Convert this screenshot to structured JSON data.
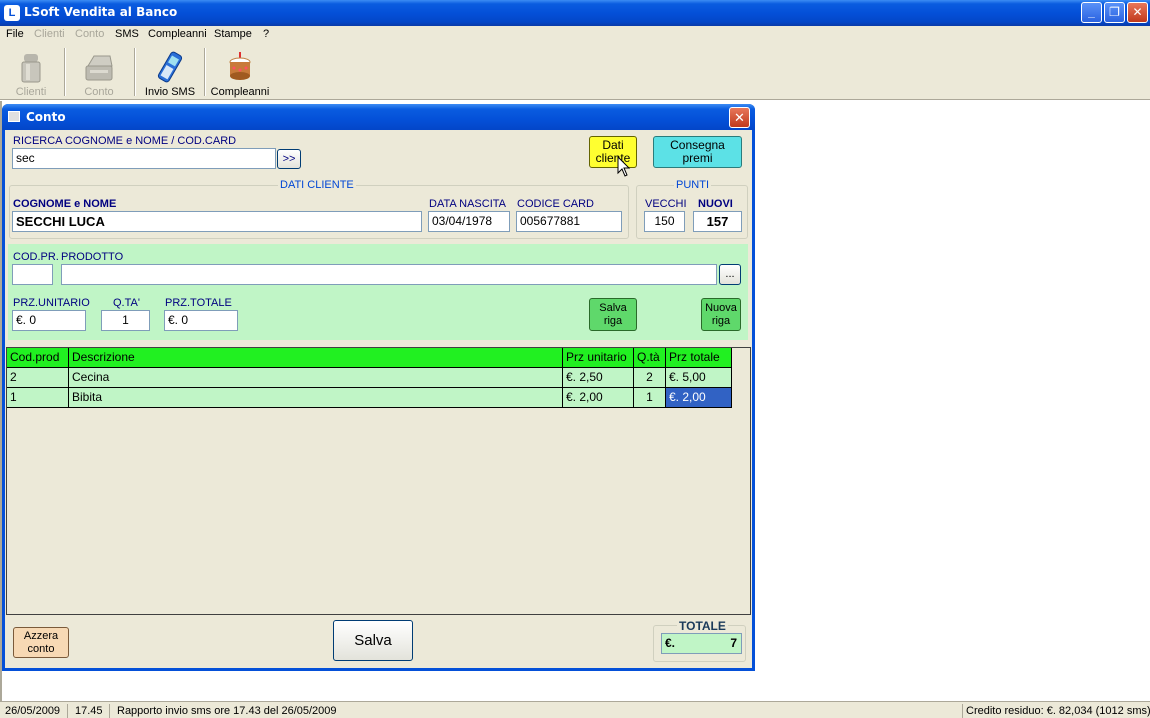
{
  "window": {
    "title": "LSoft Vendita al Banco"
  },
  "menu": {
    "items": [
      {
        "label": "File"
      },
      {
        "label": "Clienti"
      },
      {
        "label": "Conto"
      },
      {
        "label": "SMS"
      },
      {
        "label": "Compleanni"
      },
      {
        "label": "Stampe"
      },
      {
        "label": "?"
      }
    ]
  },
  "toolbar": {
    "clienti": "Clienti",
    "conto": "Conto",
    "invio_sms": "Invio SMS",
    "compleanni": "Compleanni"
  },
  "dialog": {
    "title": "Conto",
    "search": {
      "label": "RICERCA COGNOME e NOME / COD.CARD",
      "value": "sec",
      "go_label": ">>"
    },
    "dati_cliente_btn": "Dati cliente",
    "consegna_premi_btn": "Consegna premi",
    "cliente": {
      "group_title": "DATI CLIENTE",
      "nome_label": "COGNOME e NOME",
      "nome_value": "SECCHI LUCA",
      "nascita_label": "DATA NASCITA",
      "nascita_value": "03/04/1978",
      "card_label": "CODICE CARD",
      "card_value": "005677881"
    },
    "punti": {
      "group_title": "PUNTI",
      "vecchi_label": "VECCHI",
      "vecchi_value": "150",
      "nuovi_label": "NUOVI",
      "nuovi_value": "157"
    },
    "riga": {
      "codpr_label": "COD.PR.",
      "prodotto_label": "PRODOTTO",
      "codpr_value": "",
      "prodotto_value": "",
      "browse_label": "...",
      "prz_unitario_label": "PRZ.UNITARIO",
      "prz_unitario_value": "€.       0",
      "qta_label": "Q.TA'",
      "qta_value": "1",
      "prz_totale_label": "PRZ.TOTALE",
      "prz_totale_value": "€.       0",
      "salva_riga": "Salva riga",
      "nuova_riga": "Nuova riga"
    },
    "grid": {
      "columns": [
        "Cod.prod",
        "Descrizione",
        "Prz unitario",
        "Q.tà",
        "Prz totale"
      ],
      "rows": [
        {
          "cod": "2",
          "desc": "Cecina",
          "unit": "€. 2,50",
          "qta": "2",
          "tot": "€. 5,00"
        },
        {
          "cod": "1",
          "desc": "Bibita",
          "unit": "€. 2,00",
          "qta": "1",
          "tot": "€. 2,00"
        }
      ]
    },
    "azzera_btn": "Azzera conto",
    "salva_btn": "Salva",
    "totale_label": "TOTALE",
    "totale_currency": "€.",
    "totale_value": "7"
  },
  "statusbar": {
    "date": "26/05/2009",
    "time": "17.45",
    "message": "Rapporto invio sms ore 17.43 del 26/05/2009",
    "credit": "Credito residuo: €. 82,034 (1012 sms)"
  }
}
